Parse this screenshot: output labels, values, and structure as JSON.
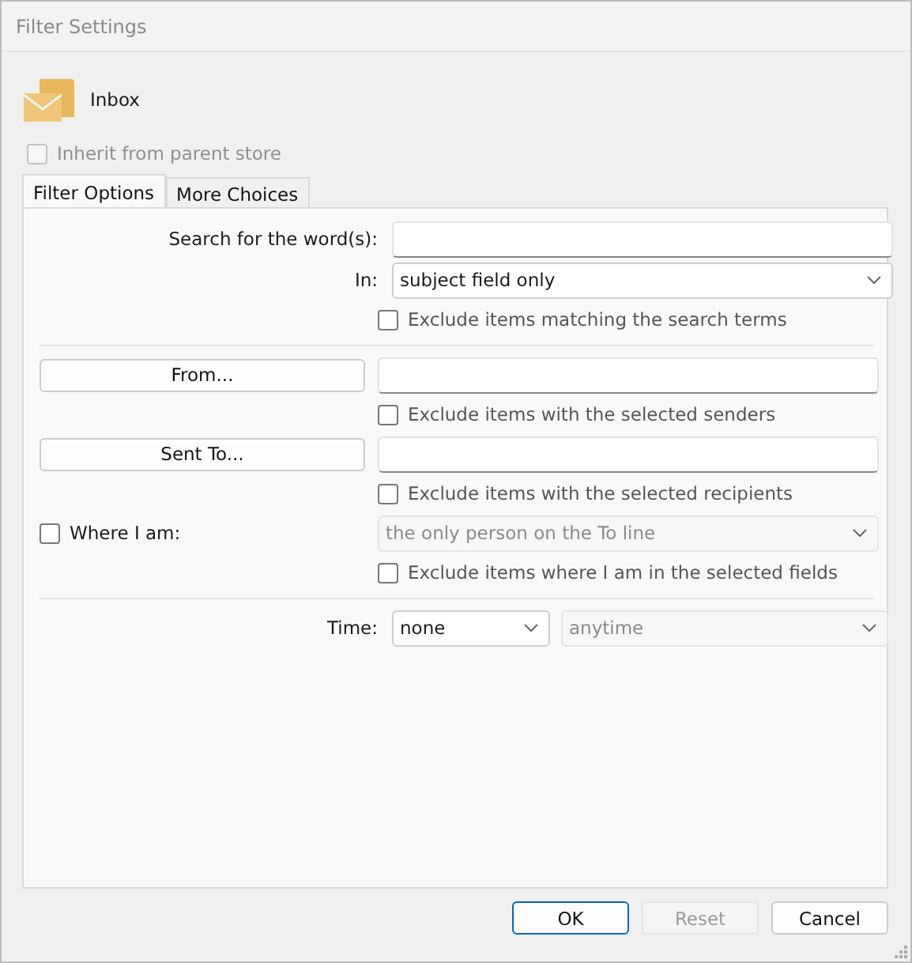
{
  "window": {
    "title": "Filter Settings"
  },
  "folder": {
    "name": "Inbox"
  },
  "inherit": {
    "label": "Inherit from parent store",
    "checked": false,
    "disabled": true
  },
  "tabs": [
    {
      "label": "Filter Options",
      "selected": true
    },
    {
      "label": "More Choices",
      "selected": false
    }
  ],
  "search": {
    "label": "Search for the word(s):"
  },
  "search_in": {
    "label": "In:",
    "value": "subject field only"
  },
  "exclude_search": {
    "label": "Exclude items matching the search terms",
    "checked": false
  },
  "from": {
    "button": "From..."
  },
  "exclude_senders": {
    "label": "Exclude items with the selected senders",
    "checked": false
  },
  "sent_to": {
    "button": "Sent To..."
  },
  "exclude_recipients": {
    "label": "Exclude items with the selected recipients",
    "checked": false
  },
  "where_i_am": {
    "label": "Where I am:",
    "checked": false,
    "value": "the only person on the To line"
  },
  "exclude_where": {
    "label": "Exclude items where I am in the selected fields",
    "checked": false
  },
  "time": {
    "label": "Time:",
    "value": "none",
    "range": "anytime"
  },
  "buttons": [
    {
      "label": "OK",
      "default": true,
      "disabled": false
    },
    {
      "label": "Reset",
      "default": false,
      "disabled": true
    },
    {
      "label": "Cancel",
      "default": false,
      "disabled": false
    }
  ]
}
